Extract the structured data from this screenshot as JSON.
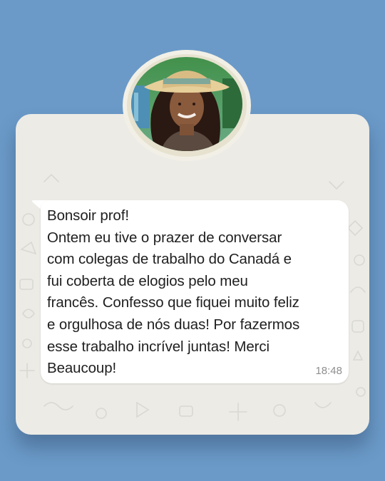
{
  "profile": {
    "avatar_icon": "woman-in-straw-hat-photo"
  },
  "message": {
    "lines": [
      "Bonsoir prof!",
      "Ontem eu tive o prazer de conversar",
      "com colegas de trabalho do Canadá e",
      "fui coberta de elogios pelo meu",
      "francês. Confesso que fiquei muito feliz",
      "e orgulhosa de nós duas! Por fazermos",
      "esse trabalho incrível juntas! Merci",
      "Beaucoup!"
    ],
    "time": "18:48"
  },
  "colors": {
    "background": "#6b9ac8",
    "card": "#ecebe6",
    "bubble": "#ffffff",
    "timestamp": "#8e8e8e"
  }
}
